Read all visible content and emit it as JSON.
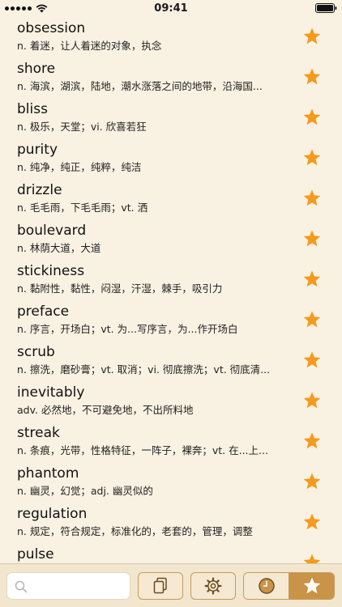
{
  "status_bar": {
    "time": "09:41"
  },
  "words": [
    {
      "word": "obsession",
      "definition": "n. 着迷，让人着迷的对象，执念"
    },
    {
      "word": "shore",
      "definition": "n. 海滨，湖滨，陆地，潮水涨落之间的地带，沿海国..."
    },
    {
      "word": "bliss",
      "definition": "n. 极乐，天堂；vi. 欣喜若狂"
    },
    {
      "word": "purity",
      "definition": "n. 纯净，纯正，纯粹，纯洁"
    },
    {
      "word": "drizzle",
      "definition": "n. 毛毛雨，下毛毛雨；vt. 洒"
    },
    {
      "word": "boulevard",
      "definition": "n. 林荫大道，大道"
    },
    {
      "word": "stickiness",
      "definition": "n. 黏附性，黏性，闷湿，汗湿，棘手，吸引力"
    },
    {
      "word": "preface",
      "definition": "n. 序言，开场白；vt. 为...写序言，为...作开场白"
    },
    {
      "word": "scrub",
      "definition": "n. 擦洗，磨砂膏；vt. 取消；vi. 彻底擦洗；vt. 彻底清..."
    },
    {
      "word": "inevitably",
      "definition": "adv. 必然地，不可避免地，不出所料地"
    },
    {
      "word": "streak",
      "definition": "n. 条痕，光带，性格特征，一阵子，裸奔；vt. 在...上..."
    },
    {
      "word": "phantom",
      "definition": "n. 幽灵，幻觉；adj. 幽灵似的"
    },
    {
      "word": "regulation",
      "definition": "n. 规定，符合规定，标准化的，老套的，管理，调整"
    },
    {
      "word": "pulse",
      "definition": ""
    }
  ],
  "toolbar": {
    "search_placeholder": "",
    "search_value": "",
    "copy_icon": "copy-icon",
    "settings_icon": "gear-icon",
    "history_icon": "clock-icon",
    "favorites_icon": "star-icon",
    "active_segment": "favorites"
  },
  "colors": {
    "background": "#f9f1e2",
    "star": "#f59a1c",
    "accent": "#c99447",
    "toolbar": "#f2e6cf"
  }
}
